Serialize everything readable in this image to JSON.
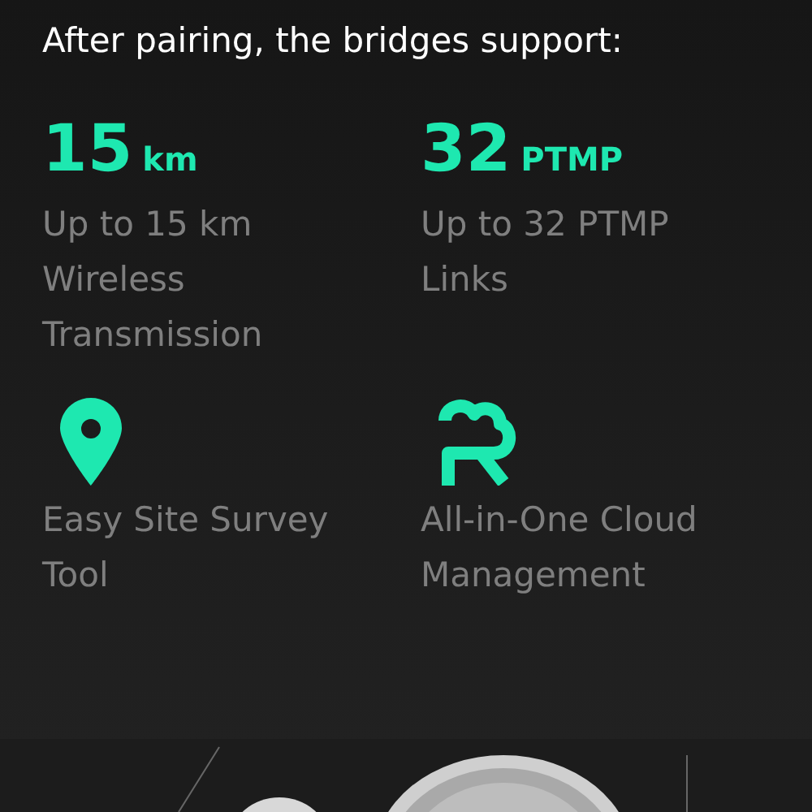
{
  "heading": "After pairing, the bridges support:",
  "features": [
    {
      "kind": "stat",
      "value": "15",
      "unit": "km",
      "description": "Up to 15 km Wireless Transmission"
    },
    {
      "kind": "stat",
      "value": "32",
      "unit": "PTMP",
      "description": "Up to 32 PTMP Links"
    },
    {
      "kind": "pin",
      "description": "Easy Site Survey Tool"
    },
    {
      "kind": "cloud",
      "description": "All-in-One Cloud Management"
    }
  ]
}
